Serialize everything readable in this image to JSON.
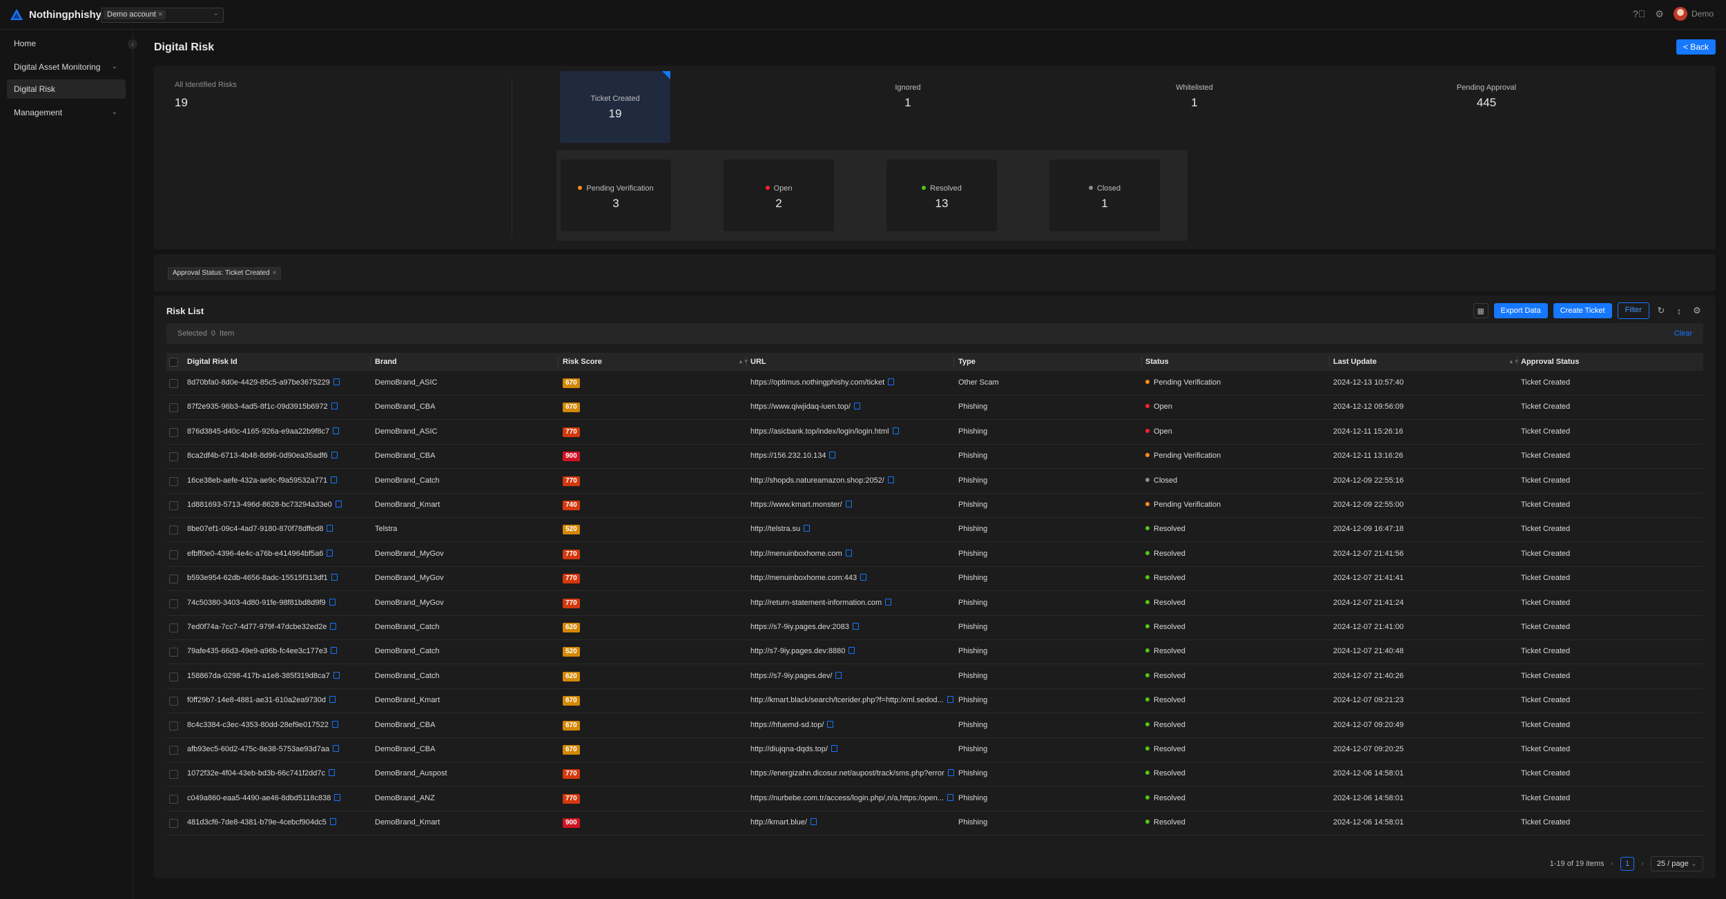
{
  "app": {
    "name": "Nothingphishy",
    "account_tag": "Demo account",
    "user_name": "Demo"
  },
  "nav": {
    "items": [
      {
        "label": "Home",
        "active": false,
        "expandable": false
      },
      {
        "label": "Digital Asset Monitoring",
        "active": false,
        "expandable": true
      },
      {
        "label": "Digital Risk",
        "active": true,
        "expandable": false
      },
      {
        "label": "Management",
        "active": false,
        "expandable": true
      }
    ]
  },
  "page": {
    "title": "Digital Risk",
    "back_label": "< Back"
  },
  "stats": {
    "all_label": "All Identified Risks",
    "all_value": "19",
    "top": [
      {
        "label": "Ticket Created",
        "value": "19",
        "selected": true
      },
      {
        "label": "Ignored",
        "value": "1"
      },
      {
        "label": "Whitelisted",
        "value": "1"
      },
      {
        "label": "Pending Approval",
        "value": "445"
      }
    ],
    "sub": [
      {
        "label": "Pending Verification",
        "value": "3",
        "color": "#fa8c16"
      },
      {
        "label": "Open",
        "value": "2",
        "color": "#f5222d"
      },
      {
        "label": "Resolved",
        "value": "13",
        "color": "#52c41a"
      },
      {
        "label": "Closed",
        "value": "1",
        "color": "#8c8c8c"
      }
    ]
  },
  "filter": {
    "key": "Approval Status:",
    "value": "Ticket Created"
  },
  "list": {
    "title": "Risk List",
    "export_label": "Export Data",
    "create_label": "Create Ticket",
    "filter_label": "Filter",
    "selected_prefix": "Selected",
    "selected_count": "0",
    "selected_suffix": "Item",
    "clear_label": "Clear",
    "columns": [
      "Digital Risk Id",
      "Brand",
      "Risk Score",
      "URL",
      "Type",
      "Status",
      "Last Update",
      "Approval Status"
    ],
    "rows": [
      {
        "id": "8d70bfa0-8d0e-4429-85c5-a97be3675229",
        "brand": "DemoBrand_ASIC",
        "score": "670",
        "url": "https://optimus.nothingphishy.com/ticket",
        "type": "Other Scam",
        "status": "Pending Verification",
        "updated": "2024-12-13 10:57:40",
        "approval": "Ticket Created"
      },
      {
        "id": "87f2e935-96b3-4ad5-8f1c-09d3915b6972",
        "brand": "DemoBrand_CBA",
        "score": "670",
        "url": "https://www.qiwjidaq-iuen.top/",
        "type": "Phishing",
        "status": "Open",
        "updated": "2024-12-12 09:56:09",
        "approval": "Ticket Created"
      },
      {
        "id": "876d3845-d40c-4165-926a-e9aa22b9f8c7",
        "brand": "DemoBrand_ASIC",
        "score": "770",
        "url": "https://asicbank.top/index/login/login.html",
        "type": "Phishing",
        "status": "Open",
        "updated": "2024-12-11 15:26:16",
        "approval": "Ticket Created"
      },
      {
        "id": "8ca2df4b-6713-4b48-8d96-0d90ea35adf6",
        "brand": "DemoBrand_CBA",
        "score": "900",
        "url": "https://156.232.10.134",
        "type": "Phishing",
        "status": "Pending Verification",
        "updated": "2024-12-11 13:16:26",
        "approval": "Ticket Created"
      },
      {
        "id": "16ce38eb-aefe-432a-ae9c-f9a59532a771",
        "brand": "DemoBrand_Catch",
        "score": "770",
        "url": "http://shopds.natureamazon.shop:2052/",
        "type": "Phishing",
        "status": "Closed",
        "updated": "2024-12-09 22:55:16",
        "approval": "Ticket Created"
      },
      {
        "id": "1d881693-5713-496d-8628-bc73294a33e0",
        "brand": "DemoBrand_Kmart",
        "score": "740",
        "url": "https://www.kmart.monster/",
        "type": "Phishing",
        "status": "Pending Verification",
        "updated": "2024-12-09 22:55:00",
        "approval": "Ticket Created"
      },
      {
        "id": "8be07ef1-09c4-4ad7-9180-870f78dffed8",
        "brand": "Telstra",
        "score": "520",
        "url": "http://telstra.su",
        "type": "Phishing",
        "status": "Resolved",
        "updated": "2024-12-09 16:47:18",
        "approval": "Ticket Created"
      },
      {
        "id": "efbff0e0-4396-4e4c-a76b-e414964bf5a6",
        "brand": "DemoBrand_MyGov",
        "score": "770",
        "url": "http://menuinboxhome.com",
        "type": "Phishing",
        "status": "Resolved",
        "updated": "2024-12-07 21:41:56",
        "approval": "Ticket Created"
      },
      {
        "id": "b593e954-62db-4656-8adc-15515f313df1",
        "brand": "DemoBrand_MyGov",
        "score": "770",
        "url": "http://menuinboxhome.com:443",
        "type": "Phishing",
        "status": "Resolved",
        "updated": "2024-12-07 21:41:41",
        "approval": "Ticket Created"
      },
      {
        "id": "74c50380-3403-4d80-91fe-98f81bd8d9f9",
        "brand": "DemoBrand_MyGov",
        "score": "770",
        "url": "http://return-statement-information.com",
        "type": "Phishing",
        "status": "Resolved",
        "updated": "2024-12-07 21:41:24",
        "approval": "Ticket Created"
      },
      {
        "id": "7ed0f74a-7cc7-4d77-979f-47dcbe32ed2e",
        "brand": "DemoBrand_Catch",
        "score": "620",
        "url": "https://s7-9iy.pages.dev:2083",
        "type": "Phishing",
        "status": "Resolved",
        "updated": "2024-12-07 21:41:00",
        "approval": "Ticket Created"
      },
      {
        "id": "79afe435-66d3-49e9-a96b-fc4ee3c177e3",
        "brand": "DemoBrand_Catch",
        "score": "520",
        "url": "http://s7-9iy.pages.dev:8880",
        "type": "Phishing",
        "status": "Resolved",
        "updated": "2024-12-07 21:40:48",
        "approval": "Ticket Created"
      },
      {
        "id": "158867da-0298-417b-a1e8-385f319d8ca7",
        "brand": "DemoBrand_Catch",
        "score": "620",
        "url": "https://s7-9iy.pages.dev/",
        "type": "Phishing",
        "status": "Resolved",
        "updated": "2024-12-07 21:40:26",
        "approval": "Ticket Created"
      },
      {
        "id": "f0ff29b7-14e8-4881-ae31-610a2ea9730d",
        "brand": "DemoBrand_Kmart",
        "score": "670",
        "url": "http://kmart.black/search/tcerider.php?f=http:/xml.sedod...",
        "type": "Phishing",
        "status": "Resolved",
        "updated": "2024-12-07 09:21:23",
        "approval": "Ticket Created"
      },
      {
        "id": "8c4c3384-c3ec-4353-80dd-28ef9e017522",
        "brand": "DemoBrand_CBA",
        "score": "670",
        "url": "https://hfuemd-sd.top/",
        "type": "Phishing",
        "status": "Resolved",
        "updated": "2024-12-07 09:20:49",
        "approval": "Ticket Created"
      },
      {
        "id": "afb93ec5-60d2-475c-8e38-5753ae93d7aa",
        "brand": "DemoBrand_CBA",
        "score": "670",
        "url": "http://diujqna-dqds.top/",
        "type": "Phishing",
        "status": "Resolved",
        "updated": "2024-12-07 09:20:25",
        "approval": "Ticket Created"
      },
      {
        "id": "1072f32e-4f04-43eb-bd3b-66c741f2dd7c",
        "brand": "DemoBrand_Auspost",
        "score": "770",
        "url": "https://energizahn.dicosur.net/aupost/track/sms.php?error",
        "type": "Phishing",
        "status": "Resolved",
        "updated": "2024-12-06 14:58:01",
        "approval": "Ticket Created"
      },
      {
        "id": "c049a860-eaa5-4490-ae46-8dbd5118c838",
        "brand": "DemoBrand_ANZ",
        "score": "770",
        "url": "https://nurbebe.com.tr/access/login.php/,n/a,https:/open...",
        "type": "Phishing",
        "status": "Resolved",
        "updated": "2024-12-06 14:58:01",
        "approval": "Ticket Created"
      },
      {
        "id": "481d3cf6-7de8-4381-b79e-4cebcf904dc5",
        "brand": "DemoBrand_Kmart",
        "score": "900",
        "url": "http://kmart.blue/",
        "type": "Phishing",
        "status": "Resolved",
        "updated": "2024-12-06 14:58:01",
        "approval": "Ticket Created"
      }
    ],
    "status_colors": {
      "Pending Verification": "#fa8c16",
      "Open": "#f5222d",
      "Resolved": "#52c41a",
      "Closed": "#8c8c8c"
    },
    "score_colors": {
      "900": "#cf1322",
      "770": "#d4380d",
      "740": "#d4380d",
      "670": "#d48806",
      "620": "#d48806",
      "520": "#d48806"
    }
  },
  "pagination": {
    "summary": "1-19 of 19 items",
    "current": "1",
    "page_size": "25 / page"
  }
}
